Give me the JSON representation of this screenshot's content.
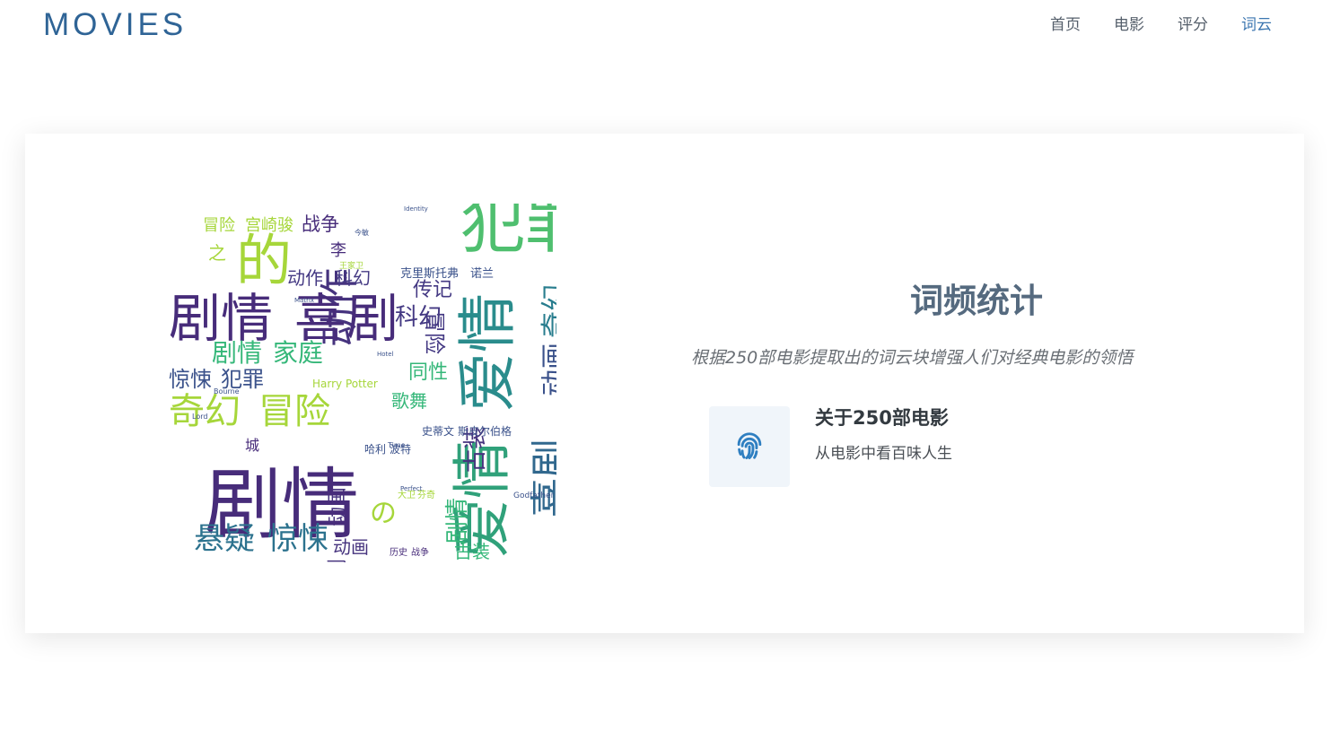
{
  "brand": "MOVIES",
  "nav": {
    "items": [
      {
        "label": "首页",
        "active": false
      },
      {
        "label": "电影",
        "active": false
      },
      {
        "label": "评分",
        "active": false
      },
      {
        "label": "词云",
        "active": true
      }
    ]
  },
  "info": {
    "title": "词频统计",
    "subtitle": "根据250部电影提取出的词云块增强人们对经典电影的领悟"
  },
  "feature": {
    "icon": "fingerprint-icon",
    "title": "关于250部电影",
    "description": "从电影中看百味人生"
  },
  "colors": {
    "brand": "#2f6496",
    "nav_active": "#3b76b0",
    "title": "#556a7f",
    "icon": "#2f7fc1",
    "icon_bg": "#f0f5fa"
  },
  "wordcloud": {
    "words": [
      "剧情",
      "剧情",
      "喜剧",
      "爱情",
      "犯罪",
      "的",
      "动作",
      "奇幻",
      "冒险",
      "悬疑",
      "惊悚",
      "剧情",
      "爱情",
      "动画",
      "奇幻",
      "喜剧",
      "音乐",
      "剧情",
      "家庭",
      "惊悚",
      "犯罪",
      "科幻",
      "同性",
      "歌舞",
      "古装",
      "动画",
      "喜剧",
      "动画",
      "战争",
      "宫崎骏",
      "冒险",
      "动作",
      "科幻",
      "传记",
      "李",
      "之",
      "の",
      "城",
      "悬疑",
      "克里斯托弗",
      "诺兰",
      "史蒂文",
      "斯皮尔伯格",
      "哈利",
      "波特",
      "Harry Potter",
      "历史",
      "战争",
      "大卫",
      "芬奇",
      "Godfather",
      "Lord",
      "Bourne",
      "Time",
      "Identity",
      "王家卫",
      "今敏",
      "Matrix",
      "Hotel",
      "Perfect"
    ]
  }
}
